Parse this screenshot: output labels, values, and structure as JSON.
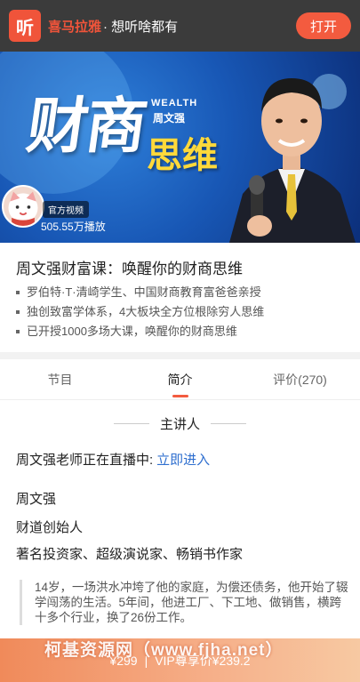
{
  "topbar": {
    "logo_glyph": "听",
    "brand": "喜马拉雅",
    "slogan": "· 想听啥都有",
    "open_button": "打开"
  },
  "banner": {
    "title_main": "财商",
    "title_sub": "思维",
    "wealth_label": "WEALTH",
    "author": "周文强",
    "official_badge": "官方视频",
    "plays": "505.55万播放"
  },
  "course": {
    "title": "周文强财富课：唤醒你的财商思维",
    "bullets": [
      "罗伯特·T·清崎学生、中国财商教育富爸爸亲授",
      "独创致富学体系，4大板块全方位根除穷人思维",
      "已开授1000多场大课，唤醒你的财商思维"
    ]
  },
  "tabs": [
    {
      "label": "节目"
    },
    {
      "label": "简介"
    },
    {
      "label": "评价(270)"
    }
  ],
  "section": {
    "speaker_heading": "主讲人",
    "live_text": "周文强老师正在直播中:",
    "live_link": "立即进入",
    "name": "周文强",
    "role": "财道创始人",
    "titles": "著名投资家、超级演说家、畅销书作家",
    "quote": "14岁，一场洪水冲垮了他的家庭，为偿还债务，他开始了辍学闯荡的生活。5年间，他进工厂、下工地、做销售，横跨十多个行业，换了26份工作。"
  },
  "price_bar": {
    "price": "¥299",
    "divider": "|",
    "vip_price": "VIP尊享价¥239.2"
  },
  "watermark": "柯基资源网（www.fjha.net）",
  "colors": {
    "accent": "#f35b3f",
    "link": "#2f6fcf",
    "topbar_bg": "#3b3b3b"
  }
}
